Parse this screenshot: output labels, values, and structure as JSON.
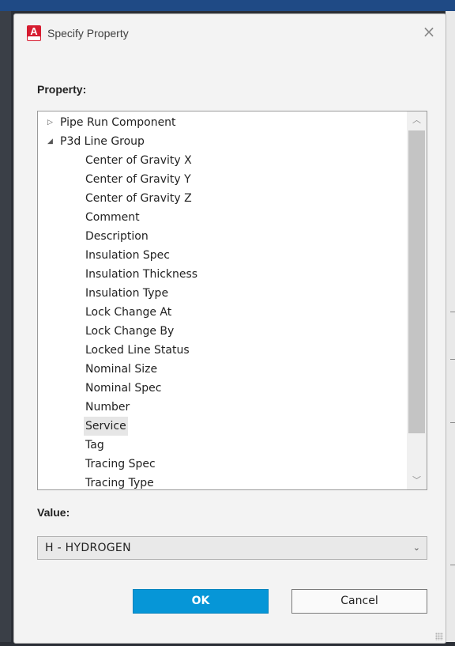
{
  "dialog": {
    "title": "Specify Property",
    "app_icon": "autocad-plant3d-app-icon",
    "app_icon_letter": "A",
    "close_icon": "close-icon",
    "close_glyph": "×"
  },
  "property": {
    "label": "Property:",
    "groups": [
      {
        "label": "Pipe Run Component",
        "expanded": false,
        "arrow": "▷"
      },
      {
        "label": "P3d Line Group",
        "expanded": true,
        "arrow": "◢"
      }
    ],
    "items": [
      "Center of Gravity X",
      "Center of Gravity Y",
      "Center of Gravity Z",
      "Comment",
      "Description",
      "Insulation Spec",
      "Insulation Thickness",
      "Insulation Type",
      "Lock Change At",
      "Lock Change By",
      "Locked Line Status",
      "Nominal Size",
      "Nominal Spec",
      "Number",
      "Service",
      "Tag",
      "Tracing Spec",
      "Tracing Type"
    ],
    "selected_item": "Service",
    "scroll_up_glyph": "︿",
    "scroll_down_glyph": "﹀"
  },
  "value": {
    "label": "Value:",
    "selected": "H - HYDROGEN",
    "chevron_glyph": "⌄"
  },
  "buttons": {
    "ok": "OK",
    "cancel": "Cancel"
  },
  "colors": {
    "ok_button": "#0696d7",
    "app_icon": "#d61c30",
    "selection": "#e6e6e6"
  }
}
